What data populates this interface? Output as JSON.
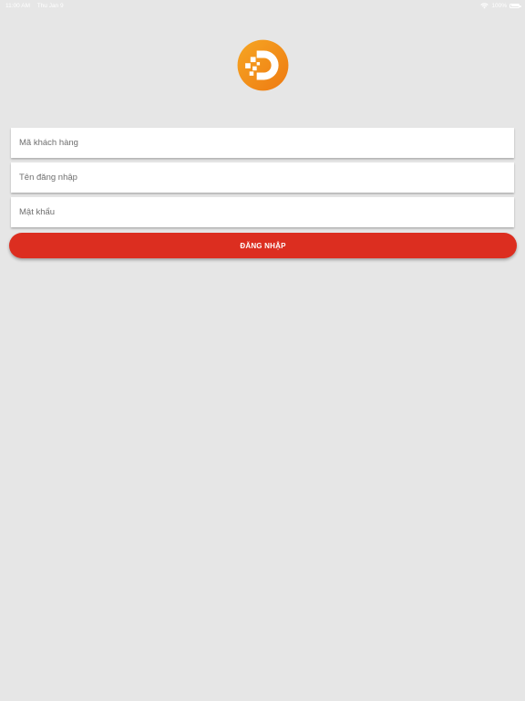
{
  "status_bar": {
    "time": "11:00 AM",
    "date": "Thu Jan 9",
    "battery": "100%",
    "icons": [
      "wifi-icon",
      "battery-icon"
    ]
  },
  "logo": {
    "icon": "brand-logo-icon",
    "colors": {
      "outer": "#f28a1a",
      "inner": "#ffffff"
    }
  },
  "form": {
    "customer_code_placeholder": "Mã khách hàng",
    "username_placeholder": "Tên đăng nhập",
    "password_placeholder": "Mật khẩu",
    "customer_code_value": "",
    "username_value": "",
    "password_value": "",
    "login_label": "ĐĂNG NHẬP"
  },
  "colors": {
    "background": "#e6e6e6",
    "button": "#dc2e20",
    "button_text": "#ffffff"
  }
}
